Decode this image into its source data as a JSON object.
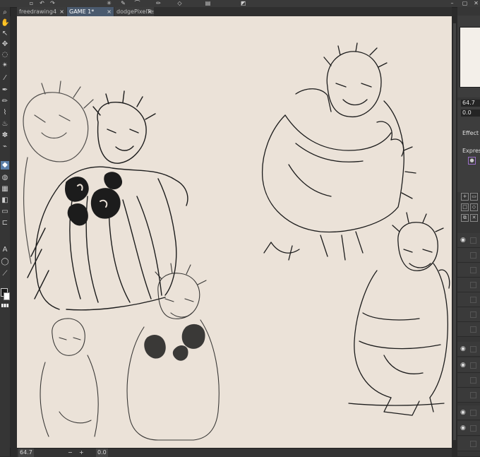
{
  "app": {
    "accent": "#5b7fa8",
    "canvas_color": "#ebe2d8",
    "ink_color": "#1c1c1c"
  },
  "toolbar_icons": [
    "save-icon",
    "undo-icon",
    "redo-icon",
    "spinner-icon",
    "pen-icon",
    "brush-icon",
    "pencil-icon",
    "shape-icon",
    "gradient-icon",
    "fill-icon"
  ],
  "tabs": [
    {
      "label": "freedrawing4",
      "active": false
    },
    {
      "label": "GAME 1*",
      "active": true
    },
    {
      "label": "dodgePixelTest",
      "active": false
    }
  ],
  "tools": [
    "zoom-icon",
    "hand-icon",
    "operation-icon",
    "move-icon",
    "lasso-icon",
    "magic-wand-icon",
    "eyedropper-icon",
    "pen-tool-icon",
    "pencil-tool-icon",
    "brush-tool-icon",
    "airbrush-icon",
    "decoration-icon",
    "blend-icon",
    "eraser-icon",
    "fill-icon",
    "gradient-icon",
    "figure-icon",
    "frame-icon",
    "ruler-icon",
    "text-icon",
    "balloon-icon",
    "correction-icon"
  ],
  "statusbar": {
    "zoom": "64.7",
    "minus": "−",
    "plus": "+",
    "rotation": "0.0"
  },
  "rightpanel": {
    "zoom_value": "64.7",
    "angle_value": "0.0",
    "effect_label": "Effect",
    "express_label": "Express"
  }
}
